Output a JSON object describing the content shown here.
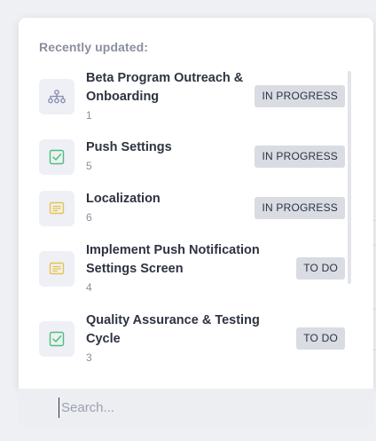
{
  "section_title": "Recently updated:",
  "items": [
    {
      "title_lines": [
        "Beta Program Outreach &",
        "Onboarding"
      ],
      "count": "1",
      "status": "IN PROGRESS",
      "icon": "hierarchy-icon"
    },
    {
      "title_lines": [
        "Push Settings"
      ],
      "count": "5",
      "status": "IN PROGRESS",
      "icon": "checkbox-icon"
    },
    {
      "title_lines": [
        "Localization"
      ],
      "count": "6",
      "status": "IN PROGRESS",
      "icon": "message-icon"
    },
    {
      "title_lines": [
        "Implement Push Notification",
        "Settings Screen"
      ],
      "count": "4",
      "status": "TO DO",
      "icon": "message-icon"
    },
    {
      "title_lines": [
        "Quality Assurance & Testing",
        "Cycle"
      ],
      "count": "3",
      "status": "TO DO",
      "icon": "checkbox-icon"
    }
  ],
  "search": {
    "placeholder": "Search..."
  },
  "colors": {
    "hierarchy": "#8a90b0",
    "checkbox": "#4cbf7a",
    "message": "#e7c449",
    "badge_bg": "#d9dce2"
  }
}
